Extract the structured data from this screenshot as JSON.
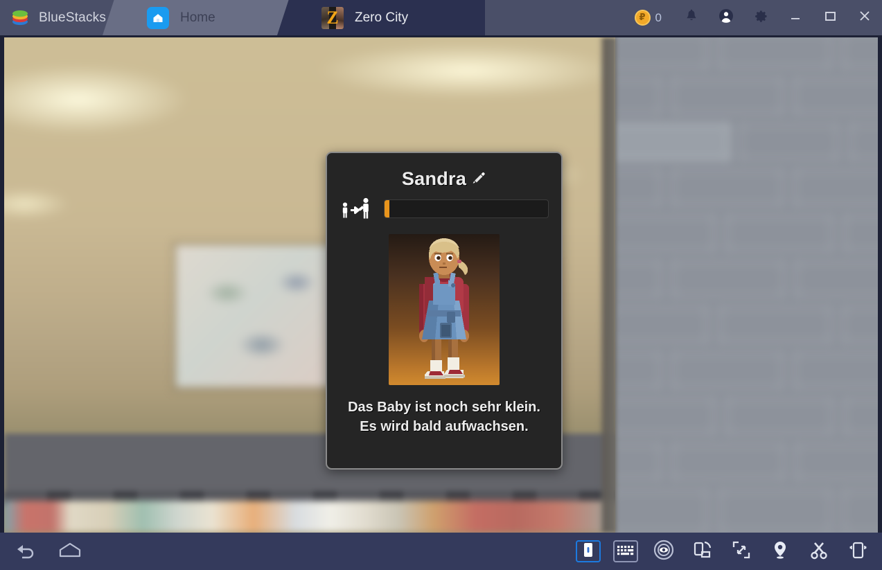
{
  "window": {
    "brand": "BlueStacks",
    "brand_logo_icon": "bluestacks-logo-icon",
    "tabs": [
      {
        "label": "Home",
        "icon": "home-icon",
        "active": false
      },
      {
        "label": "Zero City",
        "icon": "zero-city-game-icon",
        "active": true
      }
    ],
    "points": {
      "icon": "coin-icon",
      "value": "0"
    },
    "controls": [
      {
        "name": "notifications-button",
        "icon": "bell-icon"
      },
      {
        "name": "account-button",
        "icon": "avatar-icon"
      },
      {
        "name": "settings-button",
        "icon": "gear-icon"
      },
      {
        "name": "minimize-button",
        "icon": "minimize-icon"
      },
      {
        "name": "maximize-button",
        "icon": "maximize-icon"
      },
      {
        "name": "close-button",
        "icon": "close-icon"
      }
    ]
  },
  "dialog": {
    "character_name": "Sandra",
    "edit_icon": "pencil-edit-icon",
    "growth_icon": "child-to-adult-growth-icon",
    "growth_progress_percent": 3,
    "progress_fill_color": "#e8941c",
    "portrait_alt": "pixel-art girl with blonde ponytail, red shirt, blue overall dress, red sneakers",
    "description": "Das Baby ist noch sehr klein. Es wird bald aufwachsen."
  },
  "bottom_bar": {
    "left": [
      {
        "name": "back-button",
        "icon": "back-arrow-icon"
      },
      {
        "name": "home-button",
        "icon": "home-outline-icon"
      }
    ],
    "right": [
      {
        "name": "game-controls-button",
        "icon": "game-controls-icon",
        "active": true
      },
      {
        "name": "keyboard-controls-button",
        "icon": "keyboard-icon",
        "active": false
      },
      {
        "name": "eye-tracking-button",
        "icon": "eye-icon",
        "active": false
      },
      {
        "name": "rotate-device-button",
        "icon": "rotate-device-icon",
        "active": false
      },
      {
        "name": "fullscreen-button",
        "icon": "fullscreen-expand-icon",
        "active": false
      },
      {
        "name": "location-button",
        "icon": "location-pin-icon",
        "active": false
      },
      {
        "name": "cut-button",
        "icon": "scissors-icon",
        "active": false
      },
      {
        "name": "shake-device-button",
        "icon": "shake-device-icon",
        "active": false
      }
    ]
  },
  "colors": {
    "titlebar": "#4a4f68",
    "active_tab": "#2b3050",
    "inactive_tab": "#696e85",
    "bottombar": "#343a5c",
    "accent_blue": "#1c7ae0",
    "coin_gold": "#f2a928",
    "dialog_bg": "#252525",
    "dialog_border": "#8b8b8b"
  }
}
